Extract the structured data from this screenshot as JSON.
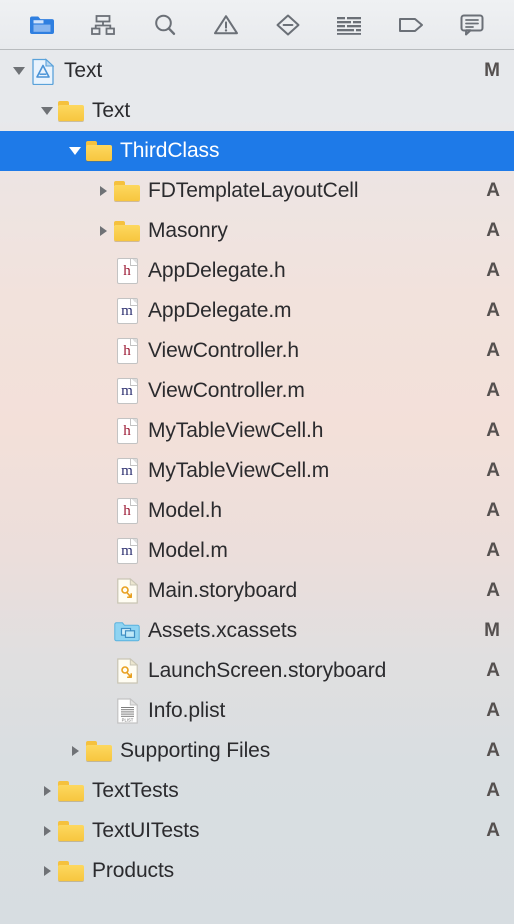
{
  "window": {
    "title": "Xcode Project Navigator"
  },
  "toolbar": {
    "items": [
      {
        "name": "project-navigator-icon",
        "label": "Show the Project navigator",
        "selected": true
      },
      {
        "name": "source-control-navigator-icon",
        "label": "Show the Source Control navigator",
        "selected": false
      },
      {
        "name": "find-navigator-icon",
        "label": "Show the Find navigator",
        "selected": false
      },
      {
        "name": "issue-navigator-icon",
        "label": "Show the Issue navigator",
        "selected": false
      },
      {
        "name": "test-navigator-icon",
        "label": "Show the Test navigator",
        "selected": false
      },
      {
        "name": "debug-navigator-icon",
        "label": "Show the Debug navigator",
        "selected": false
      },
      {
        "name": "breakpoint-navigator-icon",
        "label": "Show the Breakpoint navigator",
        "selected": false
      },
      {
        "name": "report-navigator-icon",
        "label": "Show the Report navigator",
        "selected": false
      }
    ]
  },
  "colors": {
    "selection_blue": "#1e7ae8",
    "folder_yellow": "#f7c63f",
    "header_letter": "#9c1b36",
    "source_letter": "#2a2d6e",
    "status_text": "#55504f",
    "label_text": "#2b2b2e"
  },
  "tree": {
    "rows": [
      {
        "label": "Text",
        "indent": 0,
        "twisty": "open",
        "icon": "xcodeproj",
        "status": "M"
      },
      {
        "label": "Text",
        "indent": 1,
        "twisty": "open",
        "icon": "folder",
        "status": ""
      },
      {
        "label": "ThirdClass",
        "indent": 2,
        "twisty": "open",
        "icon": "folder",
        "status": "",
        "selected": true
      },
      {
        "label": "FDTemplateLayoutCell",
        "indent": 3,
        "twisty": "collapsed",
        "icon": "folder",
        "status": "A"
      },
      {
        "label": "Masonry",
        "indent": 3,
        "twisty": "collapsed",
        "icon": "folder",
        "status": "A"
      },
      {
        "label": "AppDelegate.h",
        "indent": 3,
        "twisty": "none",
        "icon": "header",
        "status": "A"
      },
      {
        "label": "AppDelegate.m",
        "indent": 3,
        "twisty": "none",
        "icon": "source",
        "status": "A"
      },
      {
        "label": "ViewController.h",
        "indent": 3,
        "twisty": "none",
        "icon": "header",
        "status": "A"
      },
      {
        "label": "ViewController.m",
        "indent": 3,
        "twisty": "none",
        "icon": "source",
        "status": "A"
      },
      {
        "label": "MyTableViewCell.h",
        "indent": 3,
        "twisty": "none",
        "icon": "header",
        "status": "A"
      },
      {
        "label": "MyTableViewCell.m",
        "indent": 3,
        "twisty": "none",
        "icon": "source",
        "status": "A"
      },
      {
        "label": "Model.h",
        "indent": 3,
        "twisty": "none",
        "icon": "header",
        "status": "A"
      },
      {
        "label": "Model.m",
        "indent": 3,
        "twisty": "none",
        "icon": "source",
        "status": "A"
      },
      {
        "label": "Main.storyboard",
        "indent": 3,
        "twisty": "none",
        "icon": "storyboard",
        "status": "A"
      },
      {
        "label": "Assets.xcassets",
        "indent": 3,
        "twisty": "none",
        "icon": "xcassets",
        "status": "M"
      },
      {
        "label": "LaunchScreen.storyboard",
        "indent": 3,
        "twisty": "none",
        "icon": "storyboard",
        "status": "A"
      },
      {
        "label": "Info.plist",
        "indent": 3,
        "twisty": "none",
        "icon": "plist",
        "status": "A"
      },
      {
        "label": "Supporting Files",
        "indent": 2,
        "twisty": "collapsed",
        "icon": "folder",
        "status": "A"
      },
      {
        "label": "TextTests",
        "indent": 1,
        "twisty": "collapsed",
        "icon": "folder",
        "status": "A"
      },
      {
        "label": "TextUITests",
        "indent": 1,
        "twisty": "collapsed",
        "icon": "folder",
        "status": "A"
      },
      {
        "label": "Products",
        "indent": 1,
        "twisty": "collapsed",
        "icon": "folder",
        "status": ""
      }
    ]
  }
}
